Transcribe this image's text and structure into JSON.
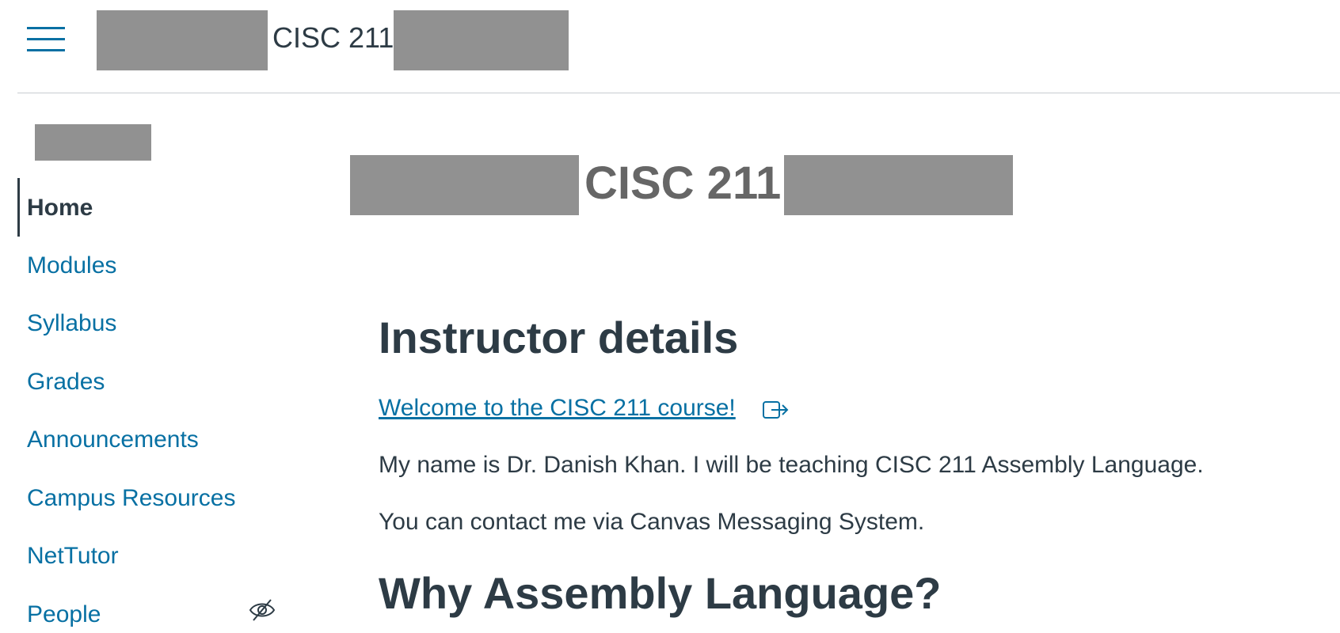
{
  "header": {
    "breadcrumb": "CISC 211",
    "menu_icon": "hamburger-menu-icon"
  },
  "sidebar": {
    "items": [
      {
        "label": "Home",
        "active": true
      },
      {
        "label": "Modules"
      },
      {
        "label": "Syllabus"
      },
      {
        "label": "Grades"
      },
      {
        "label": "Announcements"
      },
      {
        "label": "Campus Resources"
      },
      {
        "label": "NetTutor"
      },
      {
        "label": "People",
        "icon": "eye-slash-icon"
      }
    ]
  },
  "main": {
    "course_title": "CISC 211",
    "section1_heading": "Instructor details",
    "welcome_link": "Welcome to the CISC 211 course!",
    "link_icon": "external-link-icon",
    "paragraph1": "My name is Dr. Danish Khan. I will be teaching CISC 211 Assembly Language.",
    "paragraph2": "You can contact me via Canvas Messaging System.",
    "section2_heading": "Why Assembly Language?"
  },
  "colors": {
    "link": "#0770a3",
    "text": "#2d3b45",
    "redaction": "#919191",
    "course_title": "#666666"
  }
}
